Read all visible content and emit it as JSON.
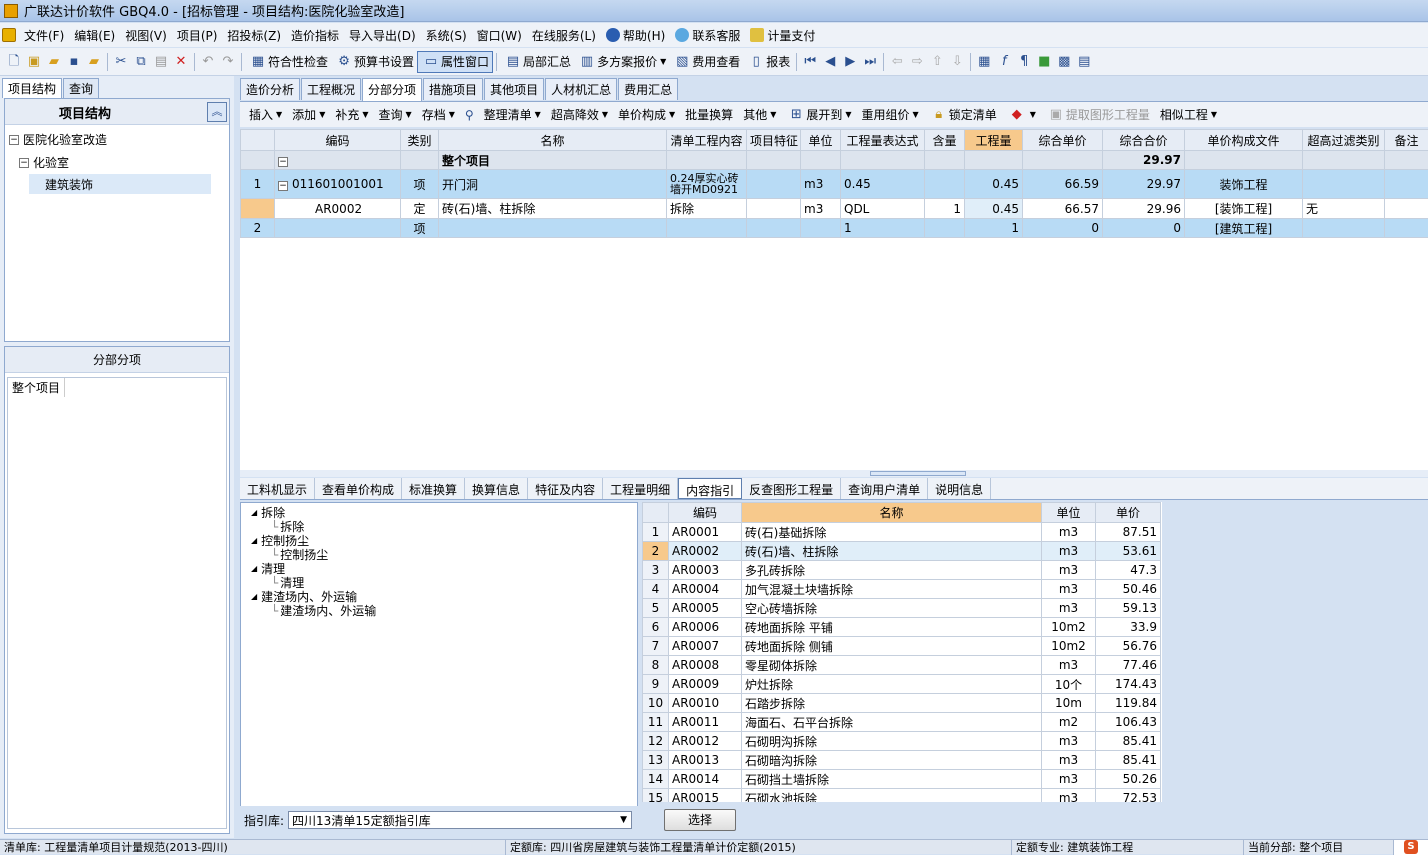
{
  "window": {
    "title": "广联达计价软件 GBQ4.0 - [招标管理 - 项目结构:医院化验室改造]"
  },
  "menu": [
    "文件(F)",
    "编辑(E)",
    "视图(V)",
    "项目(P)",
    "招投标(Z)",
    "造价指标",
    "导入导出(D)",
    "系统(S)",
    "窗口(W)",
    "在线服务(L)",
    "帮助(H)",
    "联系客服",
    "计量支付"
  ],
  "toolbar": {
    "compliance_check": "符合性检查",
    "budget_setting": "预算书设置",
    "property_window": "属性窗口",
    "local_summary": "局部汇总",
    "multi_plan_quote": "多方案报价",
    "fee_view": "费用查看",
    "report": "报表"
  },
  "left": {
    "tabs": [
      "项目结构",
      "查询"
    ],
    "header": "项目结构",
    "tree": [
      "医院化验室改造",
      "化验室",
      "建筑装饰"
    ],
    "section_title": "分部分项",
    "section_items": [
      "整个项目"
    ]
  },
  "main_tabs": [
    "造价分析",
    "工程概况",
    "分部分项",
    "措施项目",
    "其他项目",
    "人材机汇总",
    "费用汇总"
  ],
  "sub_toolbar": [
    "插入",
    "添加",
    "补充",
    "查询",
    "存档",
    "整理清单",
    "超高降效",
    "单价构成",
    "批量换算",
    "其他",
    "展开到",
    "重用组价",
    "锁定清单",
    "提取图形工程量",
    "相似工程"
  ],
  "grid": {
    "columns": [
      "",
      "编码",
      "类别",
      "名称",
      "清单工程内容",
      "项目特征",
      "单位",
      "工程量表达式",
      "含量",
      "工程量",
      "综合单价",
      "综合合价",
      "单价构成文件",
      "超高过滤类别",
      "备注"
    ],
    "group_row": {
      "name": "整个项目",
      "total": "29.97"
    },
    "rows": [
      {
        "no": "1",
        "code": "011601001001",
        "type": "项",
        "name": "开门洞",
        "content": "0.24厚实心砖墙开MD0921",
        "unit": "m3",
        "expr": "0.45",
        "content_qty": "",
        "qty": "0.45",
        "unit_price": "66.59",
        "total": "29.97",
        "file": "装饰工程",
        "filter": ""
      },
      {
        "no": "",
        "code": "AR0002",
        "type": "定",
        "name": "砖(石)墙、柱拆除",
        "content": "拆除",
        "unit": "m3",
        "expr": "QDL",
        "content_qty": "1",
        "qty": "0.45",
        "unit_price": "66.57",
        "total": "29.96",
        "file": "[装饰工程]",
        "filter": "无"
      },
      {
        "no": "2",
        "code": "",
        "type": "项",
        "name": "",
        "content": "",
        "unit": "",
        "expr": "1",
        "content_qty": "",
        "qty": "1",
        "unit_price": "0",
        "total": "0",
        "file": "[建筑工程]",
        "filter": ""
      }
    ]
  },
  "bottom_tabs": [
    "工料机显示",
    "查看单价构成",
    "标准换算",
    "换算信息",
    "特征及内容",
    "工程量明细",
    "内容指引",
    "反查图形工程量",
    "查询用户清单",
    "说明信息"
  ],
  "guide_tree": [
    {
      "label": "拆除",
      "child": "拆除"
    },
    {
      "label": "控制扬尘",
      "child": "控制扬尘"
    },
    {
      "label": "清理",
      "child": "清理"
    },
    {
      "label": "建渣场内、外运输",
      "child": "建渣场内、外运输"
    }
  ],
  "quota_table": {
    "columns": [
      "",
      "编码",
      "名称",
      "单位",
      "单价"
    ],
    "rows": [
      [
        "1",
        "AR0001",
        "砖(石)基础拆除",
        "m3",
        "87.51"
      ],
      [
        "2",
        "AR0002",
        "砖(石)墙、柱拆除",
        "m3",
        "53.61"
      ],
      [
        "3",
        "AR0003",
        "多孔砖拆除",
        "m3",
        "47.3"
      ],
      [
        "4",
        "AR0004",
        "加气混凝土块墙拆除",
        "m3",
        "50.46"
      ],
      [
        "5",
        "AR0005",
        "空心砖墙拆除",
        "m3",
        "59.13"
      ],
      [
        "6",
        "AR0006",
        "砖地面拆除 平铺",
        "10m2",
        "33.9"
      ],
      [
        "7",
        "AR0007",
        "砖地面拆除 侧铺",
        "10m2",
        "56.76"
      ],
      [
        "8",
        "AR0008",
        "零星砌体拆除",
        "m3",
        "77.46"
      ],
      [
        "9",
        "AR0009",
        "炉灶拆除",
        "10个",
        "174.43"
      ],
      [
        "10",
        "AR0010",
        "石踏步拆除",
        "10m",
        "119.84"
      ],
      [
        "11",
        "AR0011",
        "海面石、石平台拆除",
        "m2",
        "106.43"
      ],
      [
        "12",
        "AR0012",
        "石砌明沟拆除",
        "m3",
        "85.41"
      ],
      [
        "13",
        "AR0013",
        "石砌暗沟拆除",
        "m3",
        "85.41"
      ],
      [
        "14",
        "AR0014",
        "石砌挡土墙拆除",
        "m3",
        "50.26"
      ],
      [
        "15",
        "AR0015",
        "石砌水池拆除",
        "m3",
        "72.53"
      ]
    ]
  },
  "library": {
    "label": "指引库:",
    "value": "四川13清单15定额指引库",
    "button": "选择"
  },
  "status": {
    "bill_lib": "清单库: 工程量清单项目计量规范(2013-四川)",
    "quota_lib": "定额库: 四川省房屋建筑与装饰工程量清单计价定额(2015)",
    "specialty": "定额专业: 建筑装饰工程",
    "current": "当前分部: 整个项目"
  }
}
